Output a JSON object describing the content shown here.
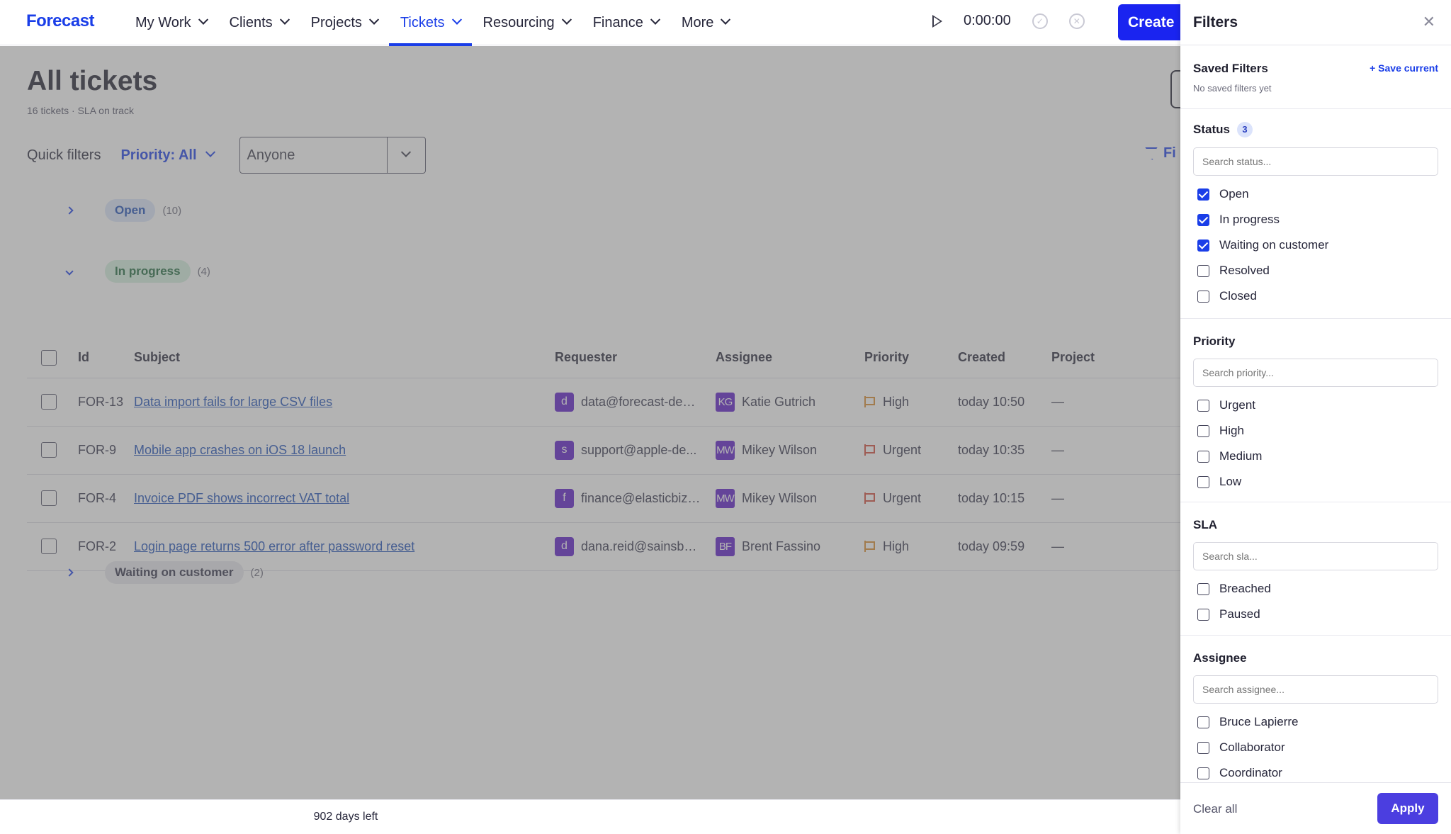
{
  "app": {
    "logo": "Forecast"
  },
  "nav": {
    "items": [
      {
        "label": "My Work"
      },
      {
        "label": "Clients"
      },
      {
        "label": "Projects"
      },
      {
        "label": "Tickets"
      },
      {
        "label": "Resourcing"
      },
      {
        "label": "Finance"
      },
      {
        "label": "More"
      }
    ],
    "active": "Tickets",
    "timer": "0:00:00",
    "create_label": "Create"
  },
  "page": {
    "title": "All tickets",
    "subtitle": "16 tickets · SLA on track",
    "quick_filters_label": "Quick filters",
    "priority_filter": "Priority: All",
    "assignee_select": "Anyone",
    "filter_link": "Fi"
  },
  "groups": {
    "open": {
      "label": "Open",
      "count": "(10)"
    },
    "in_progress": {
      "label": "In progress",
      "count": "(4)"
    },
    "waiting": {
      "label": "Waiting on customer",
      "count": "(2)"
    }
  },
  "table": {
    "headers": {
      "id": "Id",
      "subject": "Subject",
      "requester": "Requester",
      "assignee": "Assignee",
      "priority": "Priority",
      "created": "Created",
      "project": "Project"
    },
    "rows": [
      {
        "id": "FOR-13",
        "subject": "Data import fails for large CSV files",
        "req_initial": "d",
        "requester": "data@forecast-dem...",
        "asg_initials": "KG",
        "assignee": "Katie Gutrich",
        "priority": "High",
        "created": "today 10:50",
        "project": "—"
      },
      {
        "id": "FOR-9",
        "subject": "Mobile app crashes on iOS 18 launch",
        "req_initial": "s",
        "requester": "support@apple-de...",
        "asg_initials": "MW",
        "assignee": "Mikey Wilson",
        "priority": "Urgent",
        "created": "today 10:35",
        "project": "—"
      },
      {
        "id": "FOR-4",
        "subject": "Invoice PDF shows incorrect VAT total",
        "req_initial": "f",
        "requester": "finance@elasticbiz-...",
        "asg_initials": "MW",
        "assignee": "Mikey Wilson",
        "priority": "Urgent",
        "created": "today 10:15",
        "project": "—"
      },
      {
        "id": "FOR-2",
        "subject": "Login page returns 500 error after password reset",
        "req_initial": "d",
        "requester": "dana.reid@sainsbur...",
        "asg_initials": "BF",
        "assignee": "Brent Fassino",
        "priority": "High",
        "created": "today 09:59",
        "project": "—"
      }
    ]
  },
  "footer": {
    "trial": "902 days left"
  },
  "filters_panel": {
    "title": "Filters",
    "close": "✕",
    "saved": {
      "title": "Saved Filters",
      "save_current": "+ Save current",
      "empty": "No saved filters yet"
    },
    "status": {
      "title": "Status",
      "badge": "3",
      "placeholder": "Search status...",
      "options": [
        {
          "label": "Open",
          "checked": true
        },
        {
          "label": "In progress",
          "checked": true
        },
        {
          "label": "Waiting on customer",
          "checked": true
        },
        {
          "label": "Resolved",
          "checked": false
        },
        {
          "label": "Closed",
          "checked": false
        }
      ]
    },
    "priority": {
      "title": "Priority",
      "placeholder": "Search priority...",
      "options": [
        {
          "label": "Urgent"
        },
        {
          "label": "High"
        },
        {
          "label": "Medium"
        },
        {
          "label": "Low"
        }
      ]
    },
    "sla": {
      "title": "SLA",
      "placeholder": "Search sla...",
      "options": [
        {
          "label": "Breached"
        },
        {
          "label": "Paused"
        }
      ]
    },
    "assignee": {
      "title": "Assignee",
      "placeholder": "Search assignee...",
      "options": [
        {
          "label": "Bruce Lapierre"
        },
        {
          "label": "Collaborator"
        },
        {
          "label": "Coordinator"
        }
      ]
    },
    "clear_all": "Clear all",
    "apply": "Apply"
  },
  "colors": {
    "accent": "#1a3ee8",
    "create": "#1a24f0",
    "apply": "#4b3ee0",
    "avatar": "#5a17c9",
    "flag_high": "#d98a2b",
    "flag_urgent": "#d44a3a"
  }
}
